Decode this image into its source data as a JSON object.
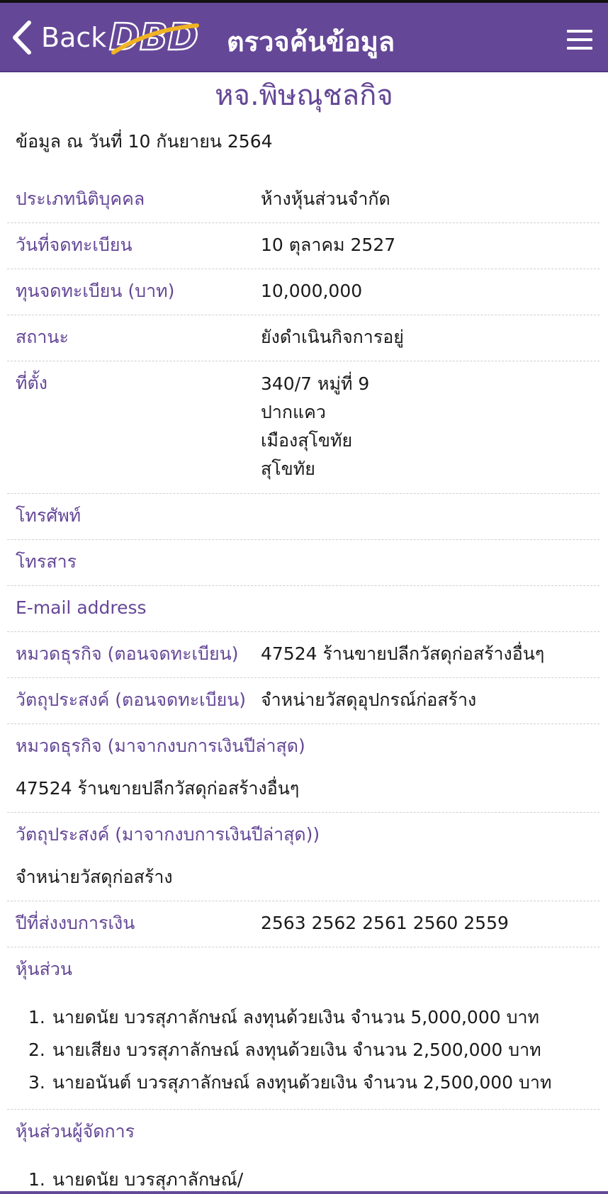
{
  "header": {
    "back_label": "Back",
    "logo_text": "DBD",
    "title": "ตรวจค้นข้อมูล"
  },
  "colors": {
    "brand": "#654797",
    "logo_yellow": "#f0b323",
    "divider": "#cfcfcf"
  },
  "company_name": "หจ.พิษณุชลกิจ",
  "as_of": "ข้อมูล ณ วันที่ 10 กันยายน 2564",
  "details": {
    "type_label": "ประเภทนิติบุคคล",
    "type_value": "ห้างหุ้นส่วนจำกัด",
    "regdate_label": "วันที่จดทะเบียน",
    "regdate_value": "10 ตุลาคม 2527",
    "capital_label": "ทุนจดทะเบียน (บาท)",
    "capital_value": "10,000,000",
    "status_label": "สถานะ",
    "status_value": "ยังดำเนินกิจการอยู่",
    "address_label": "ที่ตั้ง",
    "address_lines": [
      "340/7 หมู่ที่ 9",
      "ปากแคว",
      "เมืองสุโขทัย",
      "สุโขทัย"
    ],
    "phone_label": "โทรศัพท์",
    "fax_label": "โทรสาร",
    "email_label": "E-mail address",
    "bizcat_reg_label": "หมวดธุรกิจ (ตอนจดทะเบียน)",
    "bizcat_reg_value": "47524 ร้านขายปลีกวัสดุก่อสร้างอื่นๆ",
    "objective_reg_label": "วัตถุประสงค์ (ตอนจดทะเบียน)",
    "objective_reg_value": "จำหน่ายวัสดุอุปกรณ์ก่อสร้าง",
    "bizcat_fin_label": "หมวดธุรกิจ (มาจากงบการเงินปีล่าสุด)",
    "bizcat_fin_value": "47524 ร้านขายปลีกวัสดุก่อสร้างอื่นๆ",
    "objective_fin_label": "วัตถุประสงค์ (มาจากงบการเงินปีล่าสุด))",
    "objective_fin_value": "จำหน่ายวัสดุก่อสร้าง",
    "fin_years_label": "ปีที่ส่งงบการเงิน",
    "fin_years_value": "2563 2562 2561 2560 2559"
  },
  "partners": {
    "label": "หุ้นส่วน",
    "items": [
      {
        "num": "1.",
        "text": "นายดนัย บวรสุภาลักษณ์ ลงทุนด้วยเงิน จำนวน 5,000,000 บาท"
      },
      {
        "num": "2.",
        "text": "นายเสียง บวรสุภาลักษณ์ ลงทุนด้วยเงิน จำนวน 2,500,000 บาท"
      },
      {
        "num": "3.",
        "text": "นายอนันต์ บวรสุภาลักษณ์ ลงทุนด้วยเงิน จำนวน 2,500,000 บาท"
      }
    ]
  },
  "managing_partners": {
    "label": "หุ้นส่วนผู้จัดการ",
    "items": [
      {
        "num": "1.",
        "text": "นายดนัย บวรสุภาลักษณ์/"
      }
    ]
  }
}
